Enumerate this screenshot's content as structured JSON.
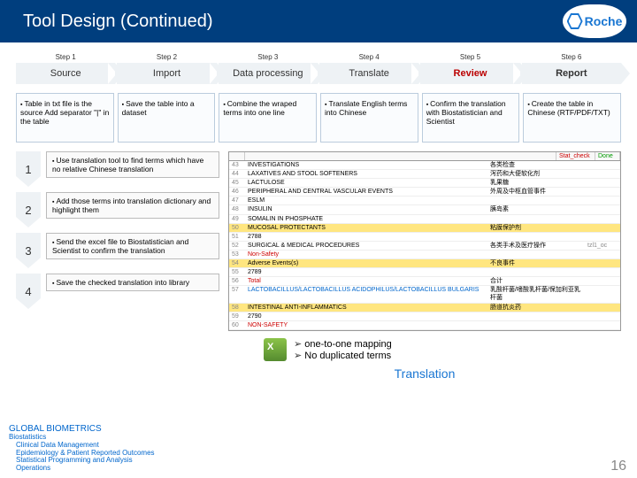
{
  "header": {
    "title": "Tool Design (Continued)",
    "logo_text": "Roche"
  },
  "steps": [
    {
      "num": "Step 1",
      "label": "Source"
    },
    {
      "num": "Step 2",
      "label": "Import"
    },
    {
      "num": "Step 3",
      "label": "Data processing"
    },
    {
      "num": "Step 4",
      "label": "Translate"
    },
    {
      "num": "Step 5",
      "label": "Review"
    },
    {
      "num": "Step 6",
      "label": "Report"
    }
  ],
  "desc": [
    "Table in txt file is the source\nAdd separator \"|\" in the table",
    "Save the table into a dataset",
    "Combine the wraped terms into one line",
    "Translate English terms into Chinese",
    "Confirm the translation with Biostatistician and Scientist",
    "Create the table in Chinese (RTF/PDF/TXT)"
  ],
  "substeps": [
    {
      "n": "1",
      "t": "Use translation tool to find terms which have no relative Chinese translation"
    },
    {
      "n": "2",
      "t": "Add those terms into translation dictionary and highlight them"
    },
    {
      "n": "3",
      "t": "Send the excel file to Biostatistician and Scientist to confirm the translation"
    },
    {
      "n": "4",
      "t": "Save the checked translation into library"
    }
  ],
  "table": {
    "headers": [
      "",
      "",
      "Stat_check",
      "Done"
    ],
    "rows": [
      {
        "c1": "43",
        "c2": "INVESTIGATIONS",
        "cn": "各类检查"
      },
      {
        "c1": "44",
        "c2": "LAXATIVES AND STOOL SOFTENERS",
        "cn": "泻药和大便软化剂"
      },
      {
        "c1": "45",
        "c2": "LACTULOSE",
        "cn": "乳果糖"
      },
      {
        "c1": "46",
        "c2": "PERIPHERAL AND CENTRAL VASCULAR EVENTS",
        "cn": "外周及中枢血管事件"
      },
      {
        "c1": "47",
        "c2": "ESLM",
        "cn": ""
      },
      {
        "c1": "48",
        "c2": "INSULIN",
        "cn": "胰岛素"
      },
      {
        "c1": "49",
        "c2": "SOMALIN IN PHOSPHATE",
        "cn": ""
      },
      {
        "c1": "50",
        "c2": "MUCOSAL PROTECTANTS",
        "cn": "粘膜保护剂",
        "hl": "y"
      },
      {
        "c1": "51",
        "c2": "2788",
        "cn": ""
      },
      {
        "c1": "52",
        "c2": "SURGICAL & MEDICAL PROCEDURES",
        "cn": "各类手术及医疗操作",
        "suf": "tzl1_oc"
      },
      {
        "c1": "53",
        "c2": "Non-Safety",
        "cn": "",
        "r": true
      },
      {
        "c1": "54",
        "c2": "Adverse Events(s)",
        "cn": "不良事件",
        "hl": "y"
      },
      {
        "c1": "55",
        "c2": "2789",
        "cn": ""
      },
      {
        "c1": "56",
        "c2": "Total",
        "cn": "合计",
        "r": true
      },
      {
        "c1": "57",
        "c2": "LACTOBACILLUS/LACTOBACILLUS ACIDOPHILUS/LACTOBACILLUS BULGARIS",
        "cn": "乳酸杆菌/嗜酸乳杆菌/保加利亚乳杆菌",
        "b": true
      },
      {
        "c1": "58",
        "c2": "INTESTINAL ANTI-INFLAMMATICS",
        "cn": "肠道抗炎药",
        "hl": "y"
      },
      {
        "c1": "59",
        "c2": "2790",
        "cn": ""
      },
      {
        "c1": "60",
        "c2": "NON-SAFETY",
        "cn": "",
        "r": true
      }
    ]
  },
  "mapping": [
    "one-to-one mapping",
    "No duplicated terms"
  ],
  "translation_label": "Translation",
  "footer": {
    "gb": "GLOBAL BIOMETRICS",
    "lines": [
      "Biostatistics",
      "Clinical Data Management",
      "Epidemiology & Patient Reported Outcomes",
      "Statistical Programming and Analysis",
      "Operations"
    ]
  },
  "pagenum": "16"
}
